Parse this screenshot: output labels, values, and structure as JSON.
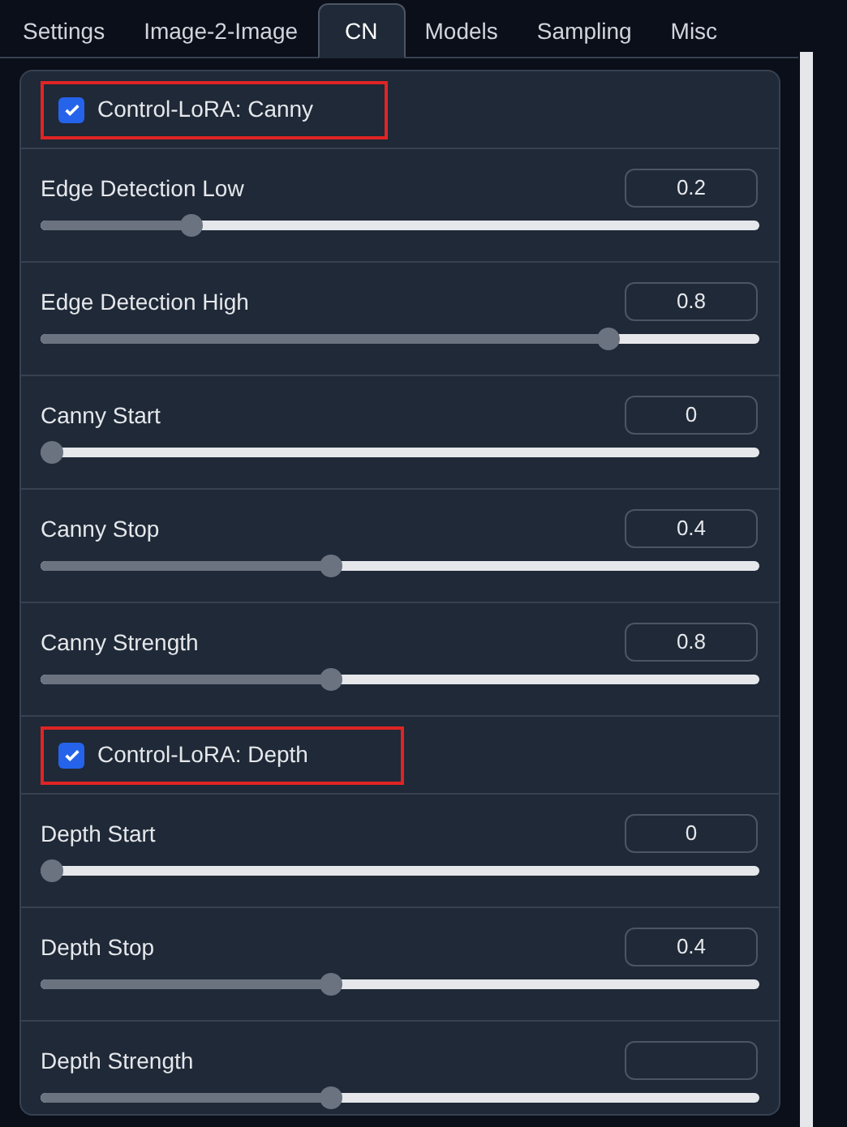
{
  "tabs": [
    {
      "label": "Settings",
      "selected": false
    },
    {
      "label": "Image-2-Image",
      "selected": false
    },
    {
      "label": "CN",
      "selected": true
    },
    {
      "label": "Models",
      "selected": false
    },
    {
      "label": "Sampling",
      "selected": false
    },
    {
      "label": "Misc",
      "selected": false
    }
  ],
  "rows": [
    {
      "kind": "checkbox",
      "label": "Control-LoRA: Canny",
      "checked": true,
      "highlighted": true
    },
    {
      "kind": "slider",
      "label": "Edge Detection Low",
      "value": "0.2",
      "level": 0.2
    },
    {
      "kind": "slider",
      "label": "Edge Detection High",
      "value": "0.8",
      "level": 0.8
    },
    {
      "kind": "slider",
      "label": "Canny Start",
      "value": "0",
      "level": 0
    },
    {
      "kind": "slider",
      "label": "Canny Stop",
      "value": "0.4",
      "level": 0.4
    },
    {
      "kind": "slider",
      "label": "Canny Strength",
      "value": "0.8",
      "level": 0.4
    },
    {
      "kind": "checkbox",
      "label": "Control-LoRA: Depth",
      "checked": true,
      "highlighted": true
    },
    {
      "kind": "slider",
      "label": "Depth Start",
      "value": "0",
      "level": 0
    },
    {
      "kind": "slider",
      "label": "Depth Stop",
      "value": "0.4",
      "level": 0.4
    },
    {
      "kind": "slider",
      "label": "Depth Strength",
      "level": 0.4
    }
  ]
}
